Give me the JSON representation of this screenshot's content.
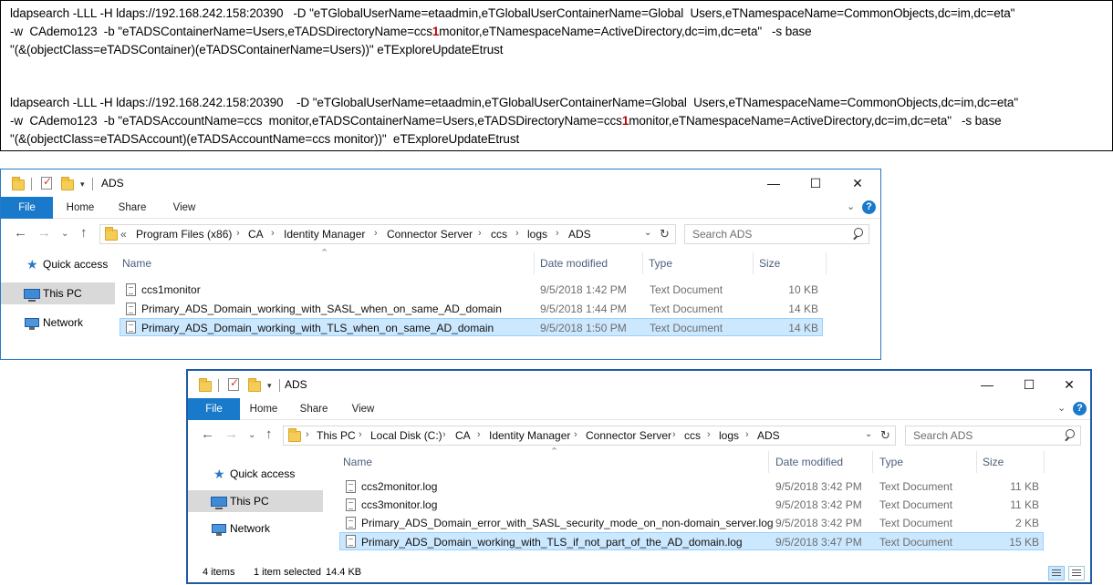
{
  "commands": {
    "cmd1_line1": "ldapsearch -LLL -H ldaps://192.168.242.158:20390   -D \"eTGlobalUserName=etaadmin,eTGlobalUserContainerName=Global  Users,eTNamespaceName=CommonObjects,dc=im,dc=eta\"",
    "cmd1_line2a": "-w  CAdemo123  -b \"eTADSContainerName=Users,eTADSDirectoryName=ccs",
    "cmd1_line2_red": "1",
    "cmd1_line2b": "monitor,eTNamespaceName=ActiveDirectory,dc=im,dc=eta\"   -s base",
    "cmd1_line3": "\"(&(objectClass=eTADSContainer)(eTADSContainerName=Users))\" eTExploreUpdateEtrust",
    "cmd2_line1": "ldapsearch -LLL -H ldaps://192.168.242.158:20390    -D \"eTGlobalUserName=etaadmin,eTGlobalUserContainerName=Global  Users,eTNamespaceName=CommonObjects,dc=im,dc=eta\"",
    "cmd2_line2a": "-w  CAdemo123  -b \"eTADSAccountName=ccs  monitor,eTADSContainerName=Users,eTADSDirectoryName=ccs",
    "cmd2_line2_red": "1",
    "cmd2_line2b": "monitor,eTNamespaceName=ActiveDirectory,dc=im,dc=eta\"   -s base",
    "cmd2_line3": "\"(&(objectClass=eTADSAccount)(eTADSAccountName=ccs monitor))\"  eTExploreUpdateEtrust"
  },
  "window1": {
    "title": "ADS",
    "tabs": {
      "file": "File",
      "home": "Home",
      "share": "Share",
      "view": "View"
    },
    "address": {
      "overflow": "«",
      "crumbs": [
        "Program Files (x86)",
        "CA",
        "Identity Manager",
        "Connector Server",
        "ccs",
        "logs",
        "ADS"
      ]
    },
    "search_placeholder": "Search ADS",
    "nav": {
      "quick_access": "Quick access",
      "this_pc": "This PC",
      "network": "Network"
    },
    "columns": {
      "name": "Name",
      "date": "Date modified",
      "type": "Type",
      "size": "Size"
    },
    "files": [
      {
        "name": "ccs1monitor",
        "date": "9/5/2018 1:42 PM",
        "type": "Text Document",
        "size": "10 KB"
      },
      {
        "name": "Primary_ADS_Domain_working_with_SASL_when_on_same_AD_domain",
        "date": "9/5/2018 1:44 PM",
        "type": "Text Document",
        "size": "14 KB"
      },
      {
        "name": "Primary_ADS_Domain_working_with_TLS_when_on_same_AD_domain",
        "date": "9/5/2018 1:50 PM",
        "type": "Text Document",
        "size": "14 KB"
      }
    ]
  },
  "window2": {
    "title": "ADS",
    "tabs": {
      "file": "File",
      "home": "Home",
      "share": "Share",
      "view": "View"
    },
    "address": {
      "crumbs": [
        "This PC",
        "Local Disk (C:)",
        "CA",
        "Identity Manager",
        "Connector Server",
        "ccs",
        "logs",
        "ADS"
      ]
    },
    "search_placeholder": "Search ADS",
    "nav": {
      "quick_access": "Quick access",
      "this_pc": "This PC",
      "network": "Network"
    },
    "columns": {
      "name": "Name",
      "date": "Date modified",
      "type": "Type",
      "size": "Size"
    },
    "files": [
      {
        "name": "ccs2monitor.log",
        "date": "9/5/2018 3:42 PM",
        "type": "Text Document",
        "size": "11 KB"
      },
      {
        "name": "ccs3monitor.log",
        "date": "9/5/2018 3:42 PM",
        "type": "Text Document",
        "size": "11 KB"
      },
      {
        "name": "Primary_ADS_Domain_error_with_SASL_security_mode_on_non-domain_server.log",
        "date": "9/5/2018 3:42 PM",
        "type": "Text Document",
        "size": "2 KB"
      },
      {
        "name": "Primary_ADS_Domain_working_with_TLS_if_not_part_of_the_AD_domain.log",
        "date": "9/5/2018 3:47 PM",
        "type": "Text Document",
        "size": "15 KB"
      }
    ],
    "status": {
      "items": "4 items",
      "selected": "1 item selected",
      "size": "14.4 KB"
    }
  }
}
